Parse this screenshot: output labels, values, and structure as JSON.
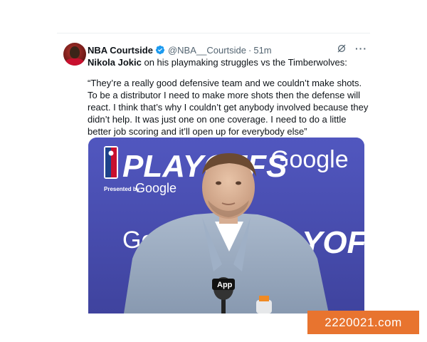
{
  "tweet": {
    "author_name": "NBA Courtside",
    "handle": "@NBA__Courtside",
    "separator": "·",
    "time": "51m",
    "lead_bold": "Nikola Jokic",
    "lead_rest": " on his playmaking struggles vs the Timberwolves:",
    "quote": "“They’re a really good defensive team and we couldn’t make shots. To be a distributor I need to make more shots then the defense will react. I think that’s why I couldn’t get anybody involved because they didn’t help. It was just one on one coverage. I need to do a little better job scoring and it’ll open up for everybody else”",
    "more_glyph": "···"
  },
  "media": {
    "backdrop_playoffs": "PLAYOFFS",
    "backdrop_presented": "Presented by",
    "backdrop_google": "Google",
    "backdrop_google_2": "Google",
    "backdrop_go": "Go",
    "backdrop_yoffs": "YOFFS",
    "mic_label": "App",
    "backdrop_color": "#4a4fb3"
  },
  "watermark": "2220021.com",
  "colors": {
    "verified": "#1d9bf0",
    "secondary_text": "#536471",
    "watermark_bg": "#e8742f"
  }
}
